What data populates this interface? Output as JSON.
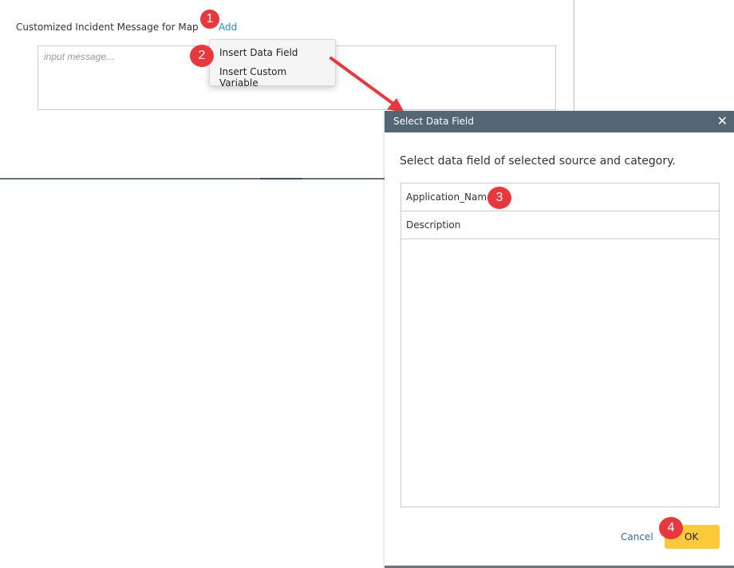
{
  "form": {
    "label": "Customized Incident Message for Map",
    "add_link": "Add",
    "placeholder": "input message..."
  },
  "menu": {
    "items": [
      "Insert Data Field",
      "Insert Custom Variable"
    ]
  },
  "dialog": {
    "title": "Select Data Field",
    "instruction": "Select data field of selected source and category.",
    "fields": [
      "Application_Name",
      "Description"
    ],
    "cancel": "Cancel",
    "ok": "OK"
  },
  "badges": [
    "1",
    "2",
    "3",
    "4"
  ],
  "colors": {
    "header": "#546673",
    "ok": "#ffca3a",
    "link": "#2e86c1",
    "badge": "#e8383d"
  }
}
